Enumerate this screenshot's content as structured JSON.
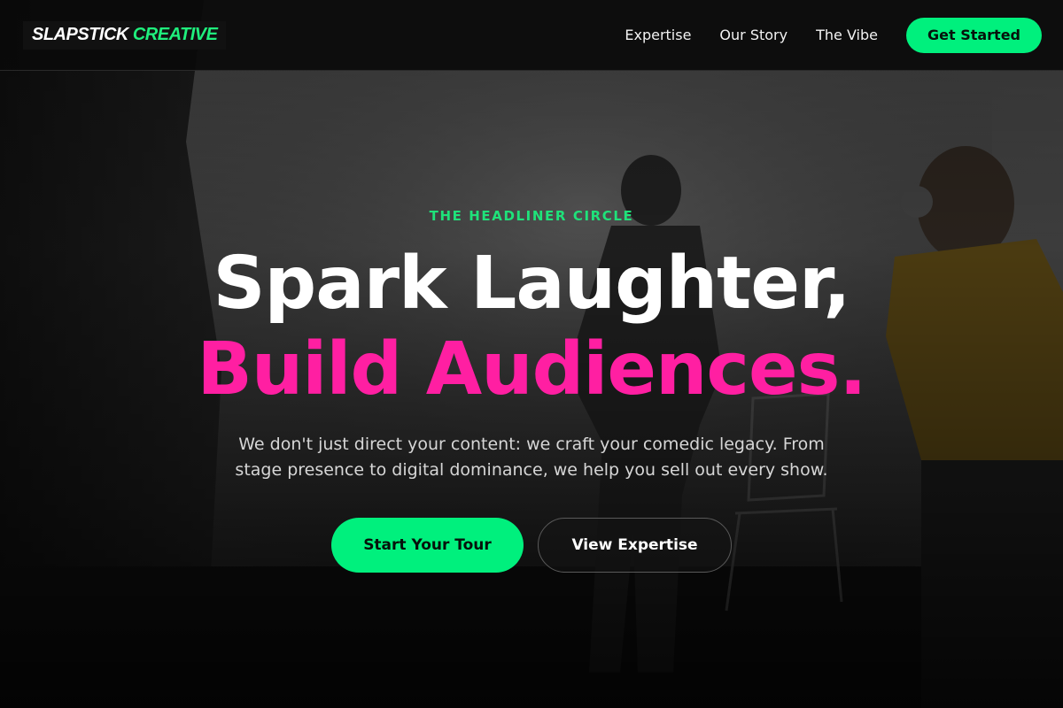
{
  "header": {
    "logo": {
      "word1": "SLAPSTICK",
      "word2": "CREATIVE"
    },
    "nav": [
      {
        "label": "Expertise"
      },
      {
        "label": "Our Story"
      },
      {
        "label": "The Vibe"
      }
    ],
    "cta_label": "Get Started"
  },
  "hero": {
    "eyebrow": "THE HEADLINER CIRCLE",
    "headline_line1": "Spark Laughter,",
    "headline_line2": "Build Audiences.",
    "lede": "We don't just direct your content: we craft your comedic legacy. From stage presence to digital dominance, we help you sell out every show.",
    "primary_button": "Start Your Tour",
    "secondary_button": "View Expertise"
  },
  "colors": {
    "accent_green": "#00f07d",
    "accent_pink": "#ff1fa2",
    "background": "#0c0c0c"
  }
}
